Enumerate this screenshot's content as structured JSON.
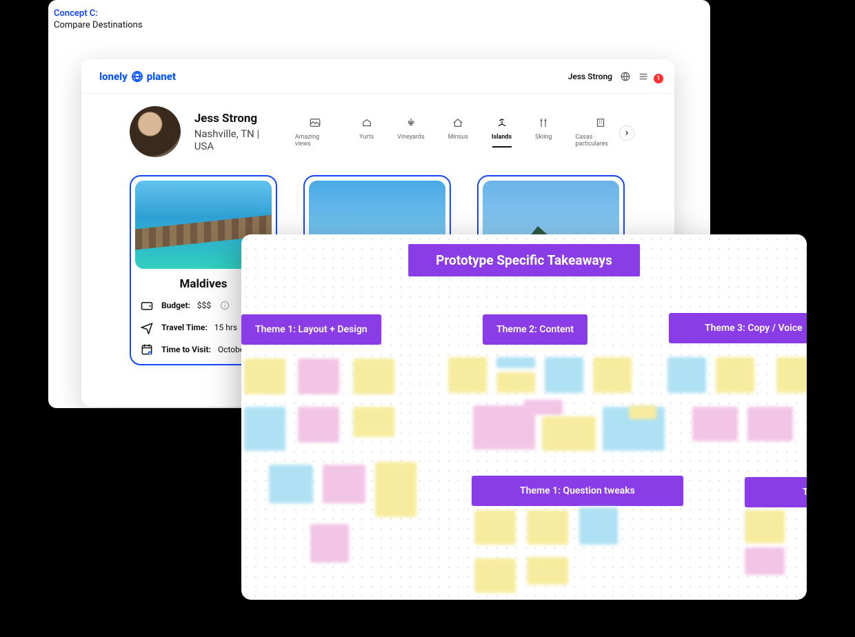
{
  "concept": {
    "label": "Concept C:",
    "subtitle": "Compare Destinations"
  },
  "brand": {
    "word1": "lonely",
    "word2": "planet"
  },
  "header": {
    "username": "Jess Strong",
    "badge": "1"
  },
  "profile": {
    "name": "Jess Strong",
    "location": "Nashville, TN | USA"
  },
  "categories": [
    {
      "label": "Amazing views"
    },
    {
      "label": "Yurts"
    },
    {
      "label": "Vineyards"
    },
    {
      "label": "Minsus"
    },
    {
      "label": "Islands",
      "active": true
    },
    {
      "label": "Skiing"
    },
    {
      "label": "Casas particulares"
    }
  ],
  "destination": {
    "title": "Maldives",
    "budget_label": "Budget:",
    "budget_value": "$$$",
    "travel_label": "Travel Time:",
    "travel_value": "15 hrs",
    "visit_label": "Time to Visit:",
    "visit_value": "October"
  },
  "whiteboard": {
    "title": "Prototype Specific Takeaways",
    "themes": {
      "t1": "Theme 1: Layout + Design",
      "t2": "Theme 2: Content",
      "t3": "Theme 3: Copy / Voice",
      "t4": "Theme 1: Question tweaks",
      "t5": "T"
    }
  }
}
